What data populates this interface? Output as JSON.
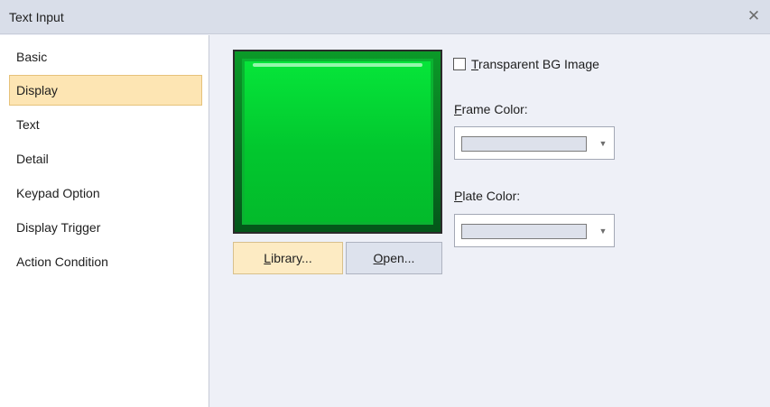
{
  "window": {
    "title": "Text Input",
    "close_icon": "close-icon"
  },
  "sidebar": {
    "items": [
      {
        "label": "Basic",
        "active": false
      },
      {
        "label": "Display",
        "active": true
      },
      {
        "label": "Text",
        "active": false
      },
      {
        "label": "Detail",
        "active": false
      },
      {
        "label": "Keypad Option",
        "active": false
      },
      {
        "label": "Display Trigger",
        "active": false
      },
      {
        "label": "Action Condition",
        "active": false
      }
    ]
  },
  "preview": {
    "color": "#02d634"
  },
  "buttons": {
    "library": {
      "mnemonic": "L",
      "rest": "ibrary..."
    },
    "open": {
      "mnemonic": "O",
      "rest": "pen..."
    }
  },
  "transparent_bg": {
    "mnemonic": "T",
    "rest": "ransparent BG Image",
    "checked": false
  },
  "frame_color": {
    "mnemonic": "F",
    "rest": "rame Color:",
    "swatch": "#dde1eb"
  },
  "plate_color": {
    "mnemonic": "P",
    "rest": "late Color:",
    "swatch": "#dde1eb"
  },
  "colors": {
    "accent_selected": "#fde5b3",
    "background": "#eef0f7"
  }
}
